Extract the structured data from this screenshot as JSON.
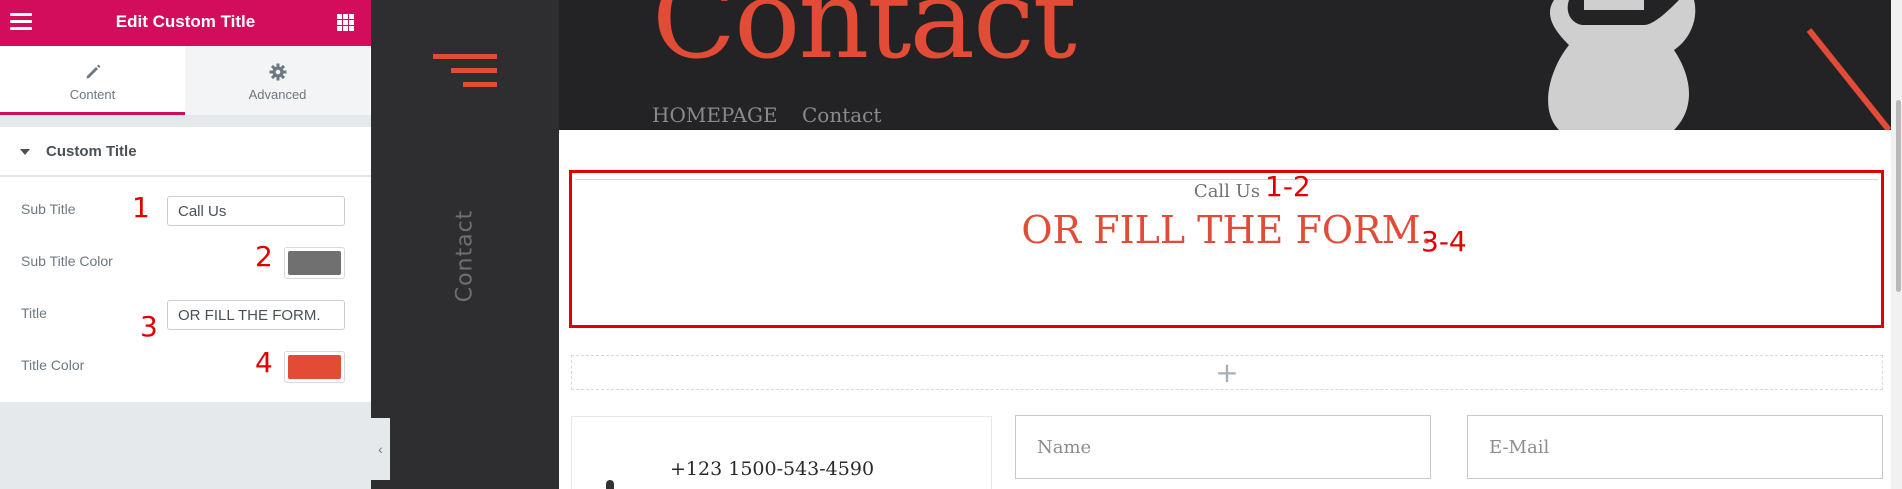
{
  "panel": {
    "title": "Edit Custom Title",
    "tabs": [
      {
        "label": "Content"
      },
      {
        "label": "Advanced"
      }
    ],
    "section_title": "Custom Title",
    "controls": {
      "subtitle": {
        "label": "Sub Title",
        "value": "Call Us",
        "annotation": "1"
      },
      "subtitle_color": {
        "label": "Sub Title Color",
        "color": "#707070",
        "annotation": "2"
      },
      "title": {
        "label": "Title",
        "value": "OR FILL THE FORM.",
        "annotation": "3"
      },
      "title_color": {
        "label": "Title Color",
        "color": "#e24b35",
        "annotation": "4"
      }
    }
  },
  "sidebar": {
    "vertical_label": "Contact"
  },
  "hero": {
    "title": "Contact",
    "breadcrumbs": [
      "HOMEPAGE",
      "Contact"
    ]
  },
  "widget": {
    "subtitle": "Call Us",
    "title": "OR FILL THE FORM.",
    "annotation_subtitle": "1-2",
    "annotation_title": "3-4"
  },
  "add_section": {
    "symbol": "+"
  },
  "contact": {
    "phone": "+123 1500-543-4590"
  },
  "form": {
    "name_placeholder": "Name",
    "email_placeholder": "E-Mail"
  },
  "colors": {
    "brand": "#d30c5c",
    "accent": "#e24b35",
    "annotation": "#e00000"
  }
}
